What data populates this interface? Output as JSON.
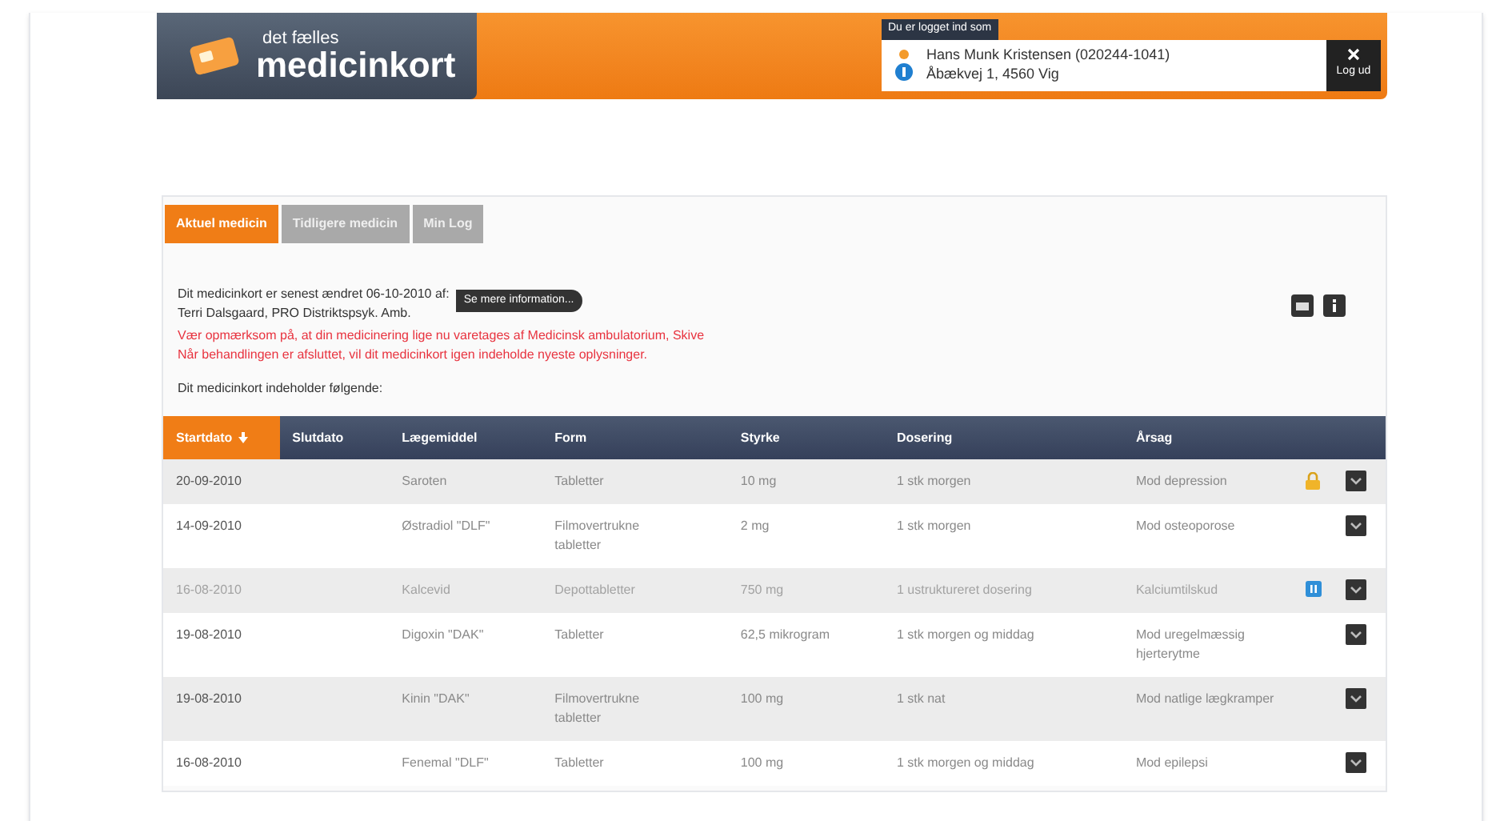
{
  "header": {
    "logo_small": "det fælles",
    "logo_big": "medicinkort",
    "login_label": "Du er logget ind som",
    "user_name": "Hans Munk Kristensen (020244-1041)",
    "user_address": "Åbækvej 1, 4560 Vig",
    "logout": "Log ud"
  },
  "tabs": [
    {
      "label": "Aktuel medicin",
      "selected": true
    },
    {
      "label": "Tidligere medicin",
      "selected": false
    },
    {
      "label": "Min Log",
      "selected": false
    }
  ],
  "info": {
    "changed_line1": "Dit medicinkort er senest ændret 06-10-2010 af:",
    "changed_line2": "Terri Dalsgaard, PRO Distriktspsyk. Amb.",
    "more_button": "Se mere information...",
    "warning": "Vær opmærksom på, at din medicinering lige nu varetages af Medicinsk ambulatorium, Skive\nNår behandlingen er afsluttet, vil dit medicinkort igen indeholde nyeste oplysninger.",
    "contains": "Dit medicinkort indeholder følgende:"
  },
  "table": {
    "columns": [
      {
        "label": "Startdato",
        "selected": true
      },
      {
        "label": "Slutdato",
        "selected": false
      },
      {
        "label": "Lægemiddel",
        "selected": false
      },
      {
        "label": "Form",
        "selected": false
      },
      {
        "label": "Styrke",
        "selected": false
      },
      {
        "label": "Dosering",
        "selected": false
      },
      {
        "label": "Årsag",
        "selected": false
      }
    ],
    "rows": [
      {
        "kind": "locked",
        "disabled": false,
        "cells": [
          "20-09-2010",
          "",
          "Saroten",
          "Tabletter",
          "10 mg",
          "1 stk morgen",
          "Mod depression"
        ]
      },
      {
        "kind": "plain",
        "disabled": false,
        "cells": [
          "14-09-2010",
          "",
          "Østradiol \"DLF\"",
          "Filmovertrukne tabletter",
          "2 mg",
          "1 stk morgen",
          "Mod osteoporose"
        ]
      },
      {
        "kind": "paused",
        "disabled": true,
        "cells": [
          "16-08-2010",
          "",
          "Kalcevid",
          "Depottabletter",
          "750 mg",
          "1 ustruktureret dosering",
          "Kalciumtilskud"
        ]
      },
      {
        "kind": "plain",
        "disabled": false,
        "cells": [
          "19-08-2010",
          "",
          "Digoxin \"DAK\"",
          "Tabletter",
          "62,5 mikrogram",
          "1 stk morgen og middag",
          "Mod uregelmæssig hjerterytme"
        ]
      },
      {
        "kind": "plain",
        "disabled": false,
        "cells": [
          "19-08-2010",
          "",
          "Kinin \"DAK\"",
          "Filmovertrukne tabletter",
          "100 mg",
          "1 stk nat",
          "Mod natlige lægkramper"
        ]
      },
      {
        "kind": "plain",
        "disabled": false,
        "cells": [
          "16-08-2010",
          "",
          "Fenemal \"DLF\"",
          "Tabletter",
          "100 mg",
          "1 stk morgen og middag",
          "Mod epilepsi"
        ]
      }
    ]
  }
}
